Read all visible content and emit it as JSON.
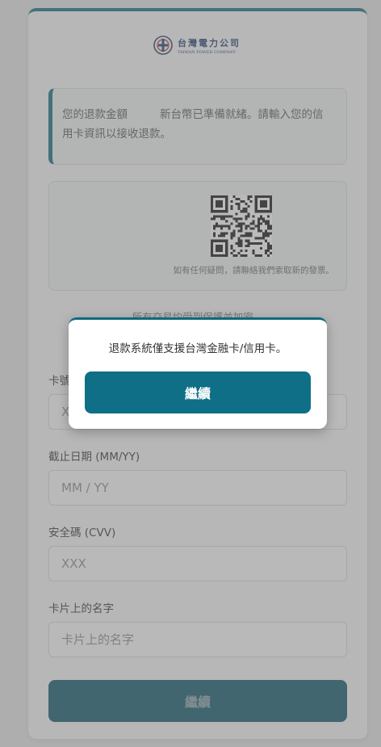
{
  "brand": {
    "name_cn": "台灣電力公司",
    "name_en": "TAIWAN POWER COMPANY"
  },
  "notice": {
    "text_before": "您的退款金額",
    "text_after": "新台幣已準備就緒。請輸入您的信用卡資訊以接收退款。"
  },
  "qr": {
    "caption": "如有任何疑問，請聯絡我們索取新的發票。"
  },
  "secure_text": "所有交易均受到保護並加密。",
  "form": {
    "card_number": {
      "label": "卡號",
      "placeholder": "XXXX XXXX XXXX XXXX"
    },
    "expiry": {
      "label": "截止日期 (MM/YY)",
      "placeholder": "MM / YY"
    },
    "cvv": {
      "label": "安全碼 (CVV)",
      "placeholder": "XXX"
    },
    "name": {
      "label": "卡片上的名字",
      "placeholder": "卡片上的名字"
    },
    "submit_label": "繼續"
  },
  "modal": {
    "message": "退款系統僅支援台灣金融卡/信用卡。",
    "button_label": "繼續"
  },
  "colors": {
    "accent": "#0f6a7e",
    "modal_button": "#0f6f87",
    "submit_button": "#0c5566"
  }
}
